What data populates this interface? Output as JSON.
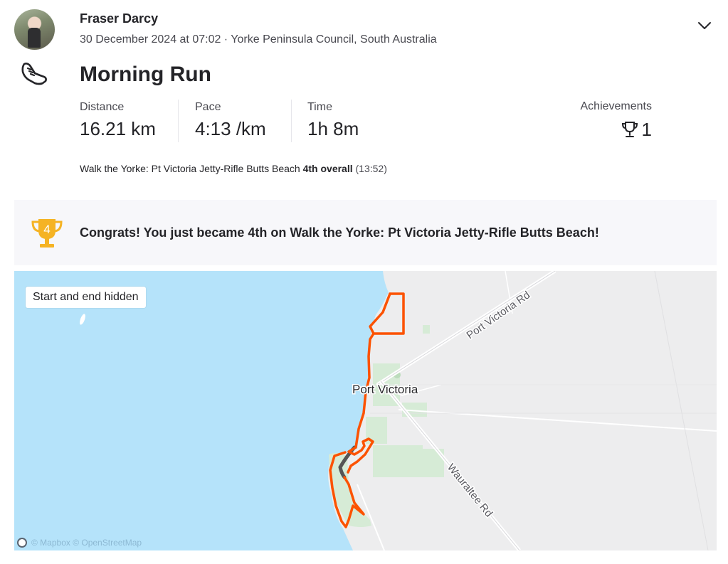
{
  "header": {
    "athlete_name": "Fraser Darcy",
    "date_location": "30 December 2024 at 07:02 · Yorke Peninsula Council, South Australia"
  },
  "activity": {
    "type_icon": "running-shoe-icon",
    "title": "Morning Run"
  },
  "stats": [
    {
      "label": "Distance",
      "value": "16.21 km"
    },
    {
      "label": "Pace",
      "value": "4:13 /km"
    },
    {
      "label": "Time",
      "value": "1h 8m"
    }
  ],
  "achievements": {
    "label": "Achievements",
    "count": "1"
  },
  "segment": {
    "name": "Walk the Yorke: Pt Victoria Jetty-Rifle Butts Beach",
    "rank": "4th overall",
    "time": "(13:52)"
  },
  "congrats": {
    "rank_badge": "4",
    "message": "Congrats! You just became 4th on Walk the Yorke: Pt Victoria Jetty-Rifle Butts Beach!"
  },
  "map": {
    "privacy_badge": "Start and end hidden",
    "labels": {
      "town": "Port Victoria",
      "road_1": "Port Victoria Rd",
      "road_2": "Wauraltee Rd"
    },
    "attribution": "© Mapbox © OpenStreetMap"
  },
  "colors": {
    "route": "#fc5200",
    "water": "#b5e3fa",
    "land": "#ededee",
    "park": "#d6ebd6",
    "trophy_gold": "#f5b324"
  }
}
